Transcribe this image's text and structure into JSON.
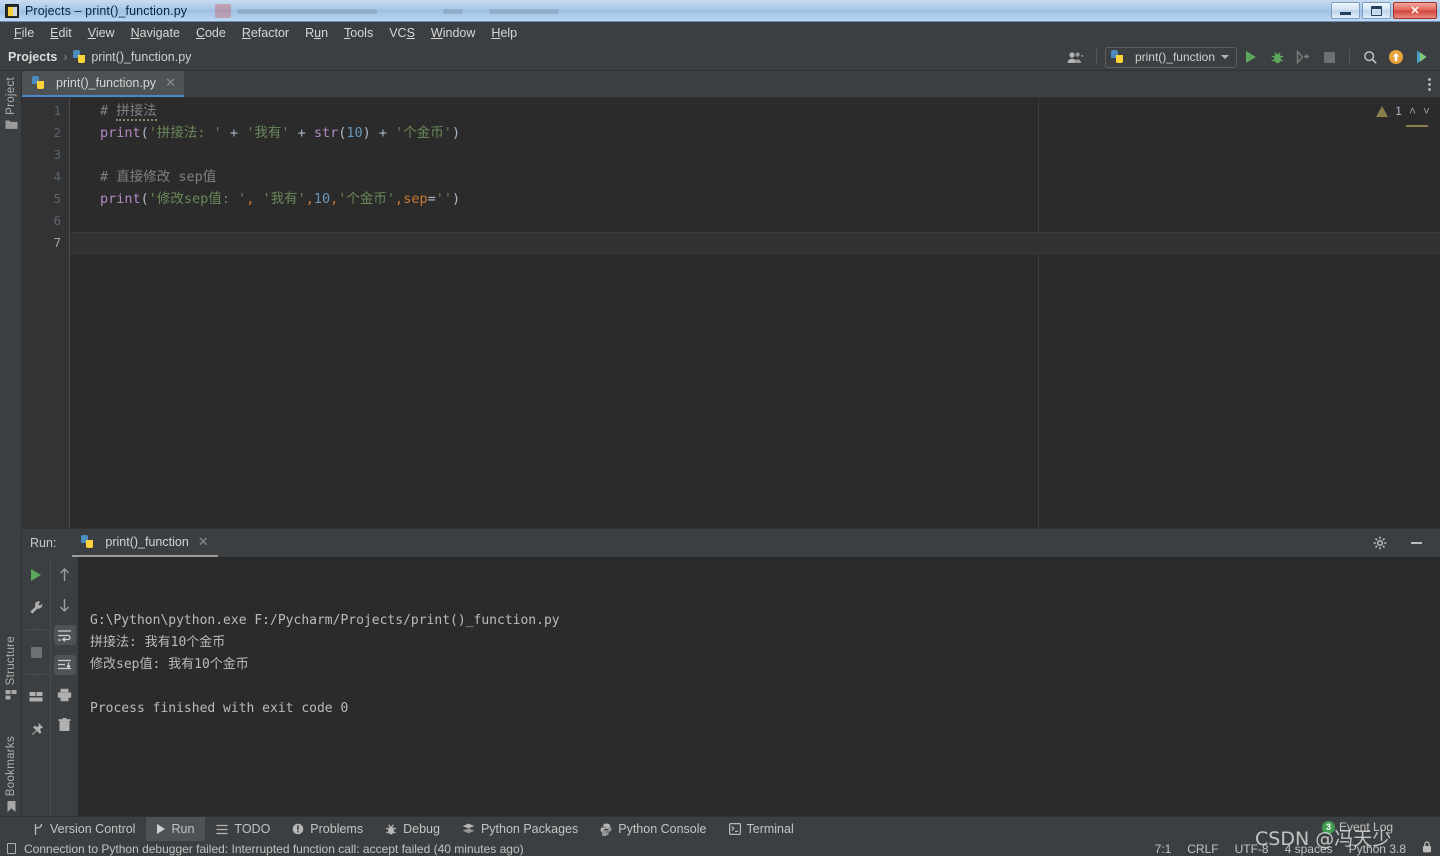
{
  "window": {
    "title": "Projects – print()_function.py",
    "buttons": {
      "minimize": "minimize",
      "maximize": "maximize",
      "close": "✕"
    }
  },
  "menubar": {
    "items": [
      {
        "label": "File",
        "mnemonic": "F"
      },
      {
        "label": "Edit",
        "mnemonic": "E"
      },
      {
        "label": "View",
        "mnemonic": "V"
      },
      {
        "label": "Navigate",
        "mnemonic": "N"
      },
      {
        "label": "Code",
        "mnemonic": "C"
      },
      {
        "label": "Refactor",
        "mnemonic": "R"
      },
      {
        "label": "Run",
        "mnemonic": "u"
      },
      {
        "label": "Tools",
        "mnemonic": "T"
      },
      {
        "label": "VCS",
        "mnemonic": "S"
      },
      {
        "label": "Window",
        "mnemonic": "W"
      },
      {
        "label": "Help",
        "mnemonic": "H"
      }
    ]
  },
  "navbar": {
    "breadcrumb_root": "Projects",
    "breadcrumb_separator": "›",
    "breadcrumb_file": "print()_function.py",
    "run_configuration": "print()_function",
    "icons": {
      "people": "people-icon",
      "run": "run-icon",
      "debug": "debug-icon",
      "coverage": "coverage-icon",
      "stop": "stop-icon",
      "search": "search-icon",
      "update": "update-icon",
      "profile": "profile-icon"
    }
  },
  "left_rail": {
    "items": [
      {
        "label": "Project",
        "icon": "folder-icon"
      },
      {
        "label": "Structure",
        "icon": "structure-icon"
      },
      {
        "label": "Bookmarks",
        "icon": "bookmark-icon"
      }
    ]
  },
  "editor": {
    "tab": {
      "label": "print()_function.py",
      "close": "✕"
    },
    "inspection": {
      "warning_count": "1",
      "up": "˄",
      "down": "˅"
    },
    "line_numbers": [
      "1",
      "2",
      "3",
      "4",
      "5",
      "6",
      "7"
    ],
    "current_line": 7,
    "lines": [
      {
        "n": 1,
        "tokens": [
          {
            "t": "# ",
            "c": "cm"
          },
          {
            "t": "拼接法",
            "c": "cm squig"
          }
        ]
      },
      {
        "n": 2,
        "tokens": [
          {
            "t": "print",
            "c": "fn"
          },
          {
            "t": "(",
            "c": "pl"
          },
          {
            "t": "'拼接法: '",
            "c": "str"
          },
          {
            "t": " + ",
            "c": "op"
          },
          {
            "t": "'我有'",
            "c": "str"
          },
          {
            "t": " + ",
            "c": "op"
          },
          {
            "t": "str",
            "c": "fn"
          },
          {
            "t": "(",
            "c": "pl"
          },
          {
            "t": "10",
            "c": "num"
          },
          {
            "t": ")",
            "c": "pl"
          },
          {
            "t": " + ",
            "c": "op"
          },
          {
            "t": "'个金币'",
            "c": "str"
          },
          {
            "t": ")",
            "c": "pl"
          }
        ]
      },
      {
        "n": 3,
        "tokens": []
      },
      {
        "n": 4,
        "tokens": [
          {
            "t": "# 直接修改 sep值",
            "c": "cm"
          }
        ]
      },
      {
        "n": 5,
        "tokens": [
          {
            "t": "print",
            "c": "fn"
          },
          {
            "t": "(",
            "c": "pl"
          },
          {
            "t": "'修改sep值: '",
            "c": "str"
          },
          {
            "t": ",",
            "c": "kw"
          },
          {
            "t": " ",
            "c": "pl"
          },
          {
            "t": "'我有'",
            "c": "str"
          },
          {
            "t": ",",
            "c": "kw"
          },
          {
            "t": "10",
            "c": "num"
          },
          {
            "t": ",",
            "c": "kw"
          },
          {
            "t": "'个金币'",
            "c": "str"
          },
          {
            "t": ",",
            "c": "kw"
          },
          {
            "t": "sep",
            "c": "kw"
          },
          {
            "t": "=",
            "c": "pl"
          },
          {
            "t": "''",
            "c": "str"
          },
          {
            "t": ")",
            "c": "pl"
          }
        ]
      },
      {
        "n": 6,
        "tokens": []
      },
      {
        "n": 7,
        "tokens": []
      }
    ]
  },
  "run_window": {
    "label": "Run:",
    "tab": "print()_function",
    "tab_close": "✕",
    "settings_icon": "gear-icon",
    "minimize_icon": "minimize-icon",
    "toolbar_left": [
      "rerun-icon",
      "wrench-icon",
      "stop-icon",
      "layout-icon",
      "pin-icon"
    ],
    "toolbar_right": [
      "up-arrow-icon",
      "down-arrow-icon",
      "soft-wrap-icon",
      "scroll-end-icon",
      "print-icon",
      "trash-icon"
    ],
    "console": [
      "G:\\Python\\python.exe F:/Pycharm/Projects/print()_function.py",
      "拼接法: 我有10个金币",
      "修改sep值: 我有10个金币",
      "",
      "Process finished with exit code 0"
    ]
  },
  "bottom_bar": {
    "items": [
      {
        "label": "Version Control",
        "icon": "branch-icon",
        "active": false
      },
      {
        "label": "Run",
        "icon": "run-icon",
        "active": true
      },
      {
        "label": "TODO",
        "icon": "todo-icon",
        "active": false
      },
      {
        "label": "Problems",
        "icon": "problems-icon",
        "active": false
      },
      {
        "label": "Debug",
        "icon": "debug-icon",
        "active": false
      },
      {
        "label": "Python Packages",
        "icon": "packages-icon",
        "active": false
      },
      {
        "label": "Python Console",
        "icon": "python-icon",
        "active": false
      },
      {
        "label": "Terminal",
        "icon": "terminal-icon",
        "active": false
      }
    ]
  },
  "status_bar": {
    "message": "Connection to Python debugger failed: Interrupted function call: accept failed (40 minutes ago)",
    "caret_position": "7:1",
    "line_separator": "CRLF",
    "encoding": "UTF-8",
    "indent": "4 spaces",
    "interpreter": "Python 3.8",
    "lock_icon": "lock-icon",
    "event_log": {
      "label": "Event Log",
      "count": "3"
    }
  },
  "watermark": "CSDN @冯天少"
}
